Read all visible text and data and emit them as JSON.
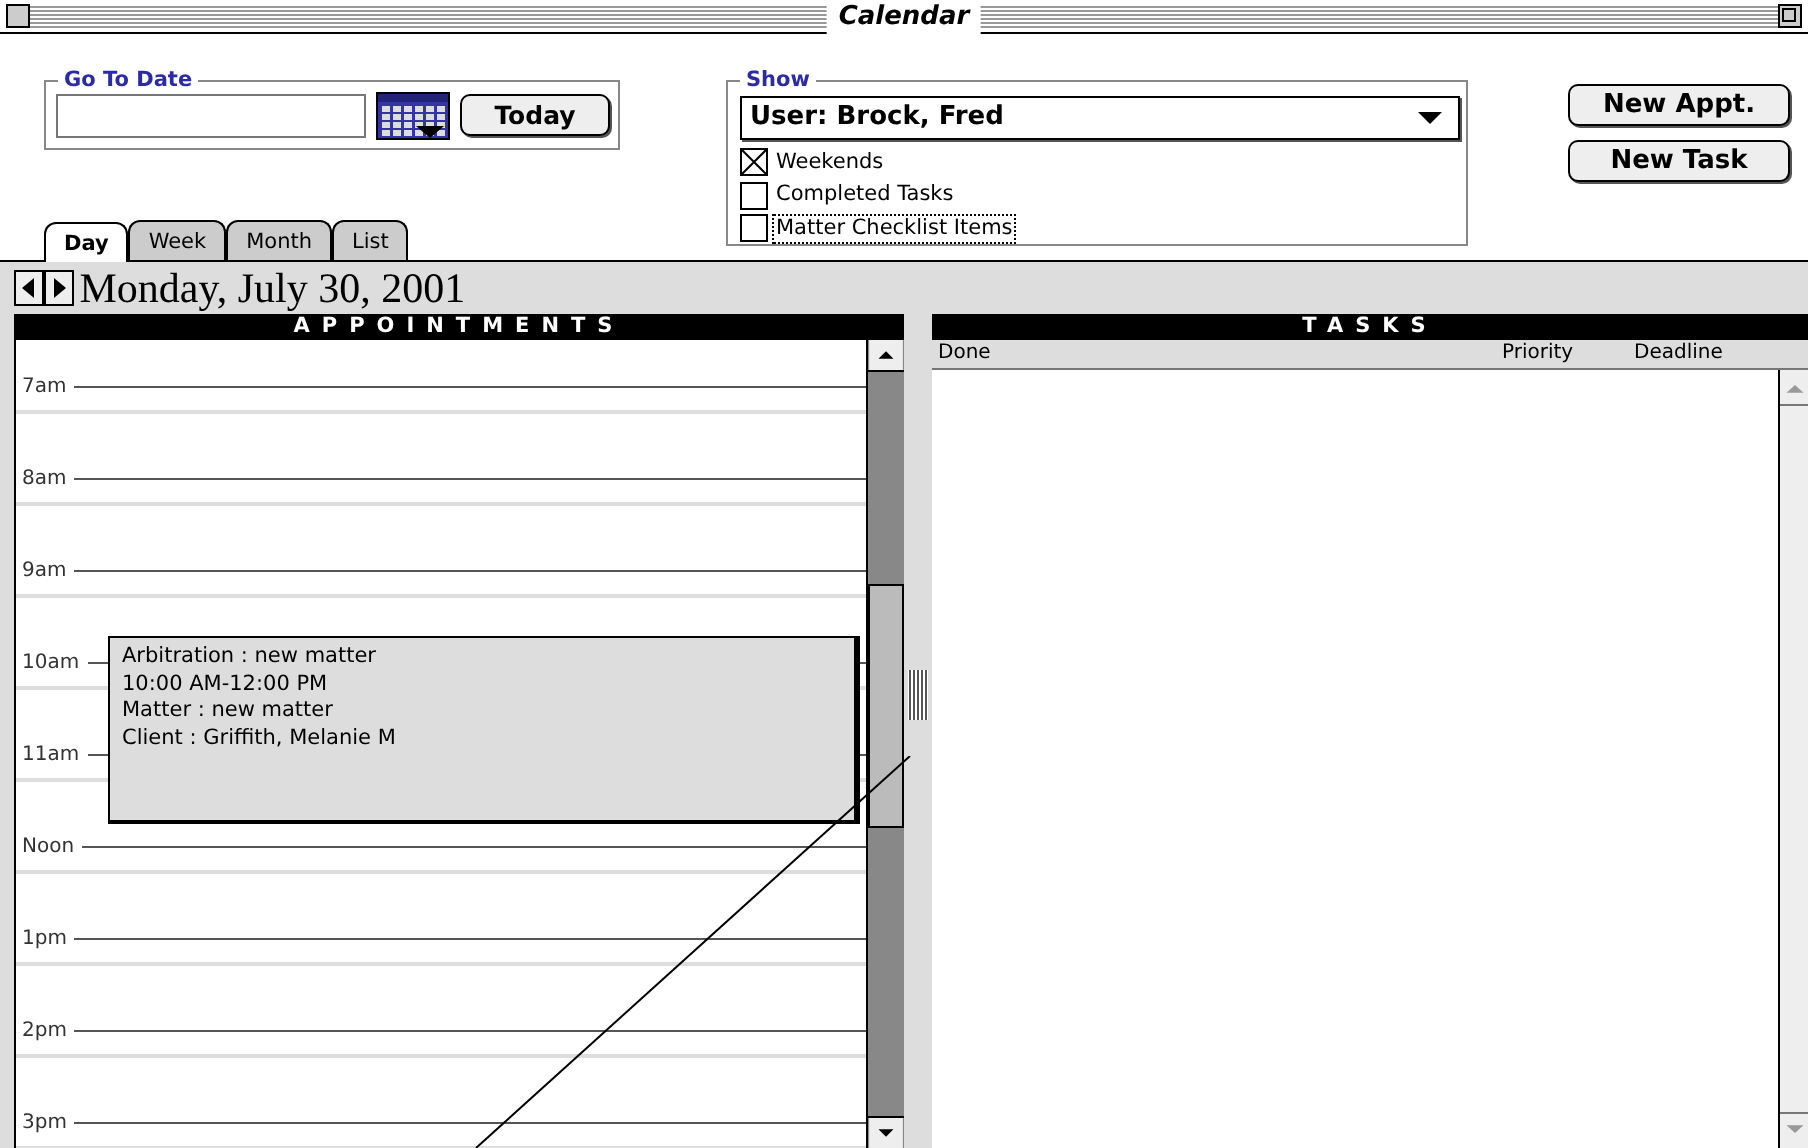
{
  "window": {
    "title": "Calendar"
  },
  "go_to_date": {
    "label": "Go To Date",
    "today_button": "Today"
  },
  "show": {
    "label": "Show",
    "user": "User: Brock, Fred",
    "options": [
      {
        "label": "Weekends",
        "checked": true,
        "focused": false
      },
      {
        "label": "Completed Tasks",
        "checked": false,
        "focused": false
      },
      {
        "label": "Matter Checklist Items",
        "checked": false,
        "focused": true
      }
    ]
  },
  "buttons": [
    "New Appt.",
    "New Task"
  ],
  "tabs": [
    {
      "label": "Day",
      "selected": true
    },
    {
      "label": "Week",
      "selected": false
    },
    {
      "label": "Month",
      "selected": false
    },
    {
      "label": "List",
      "selected": false
    }
  ],
  "date": "Monday, July 30, 2001",
  "appointments": {
    "title": "APPOINTMENTS",
    "hours": [
      {
        "label": "7am"
      },
      {
        "label": "8am"
      },
      {
        "label": "9am"
      },
      {
        "label": "10am",
        "events": [
          {
            "lines": [
              "Arbitration : new matter",
              "10:00 AM-12:00 PM",
              "Matter : new matter",
              "Client : Griffith, Melanie M"
            ]
          }
        ]
      },
      {
        "label": "11am"
      },
      {
        "label": "Noon"
      },
      {
        "label": "1pm"
      },
      {
        "label": "2pm"
      },
      {
        "label": "3pm"
      }
    ]
  },
  "tasks": {
    "title": "TASKS",
    "columns": [
      "Done",
      "Priority",
      "Deadline"
    ]
  }
}
